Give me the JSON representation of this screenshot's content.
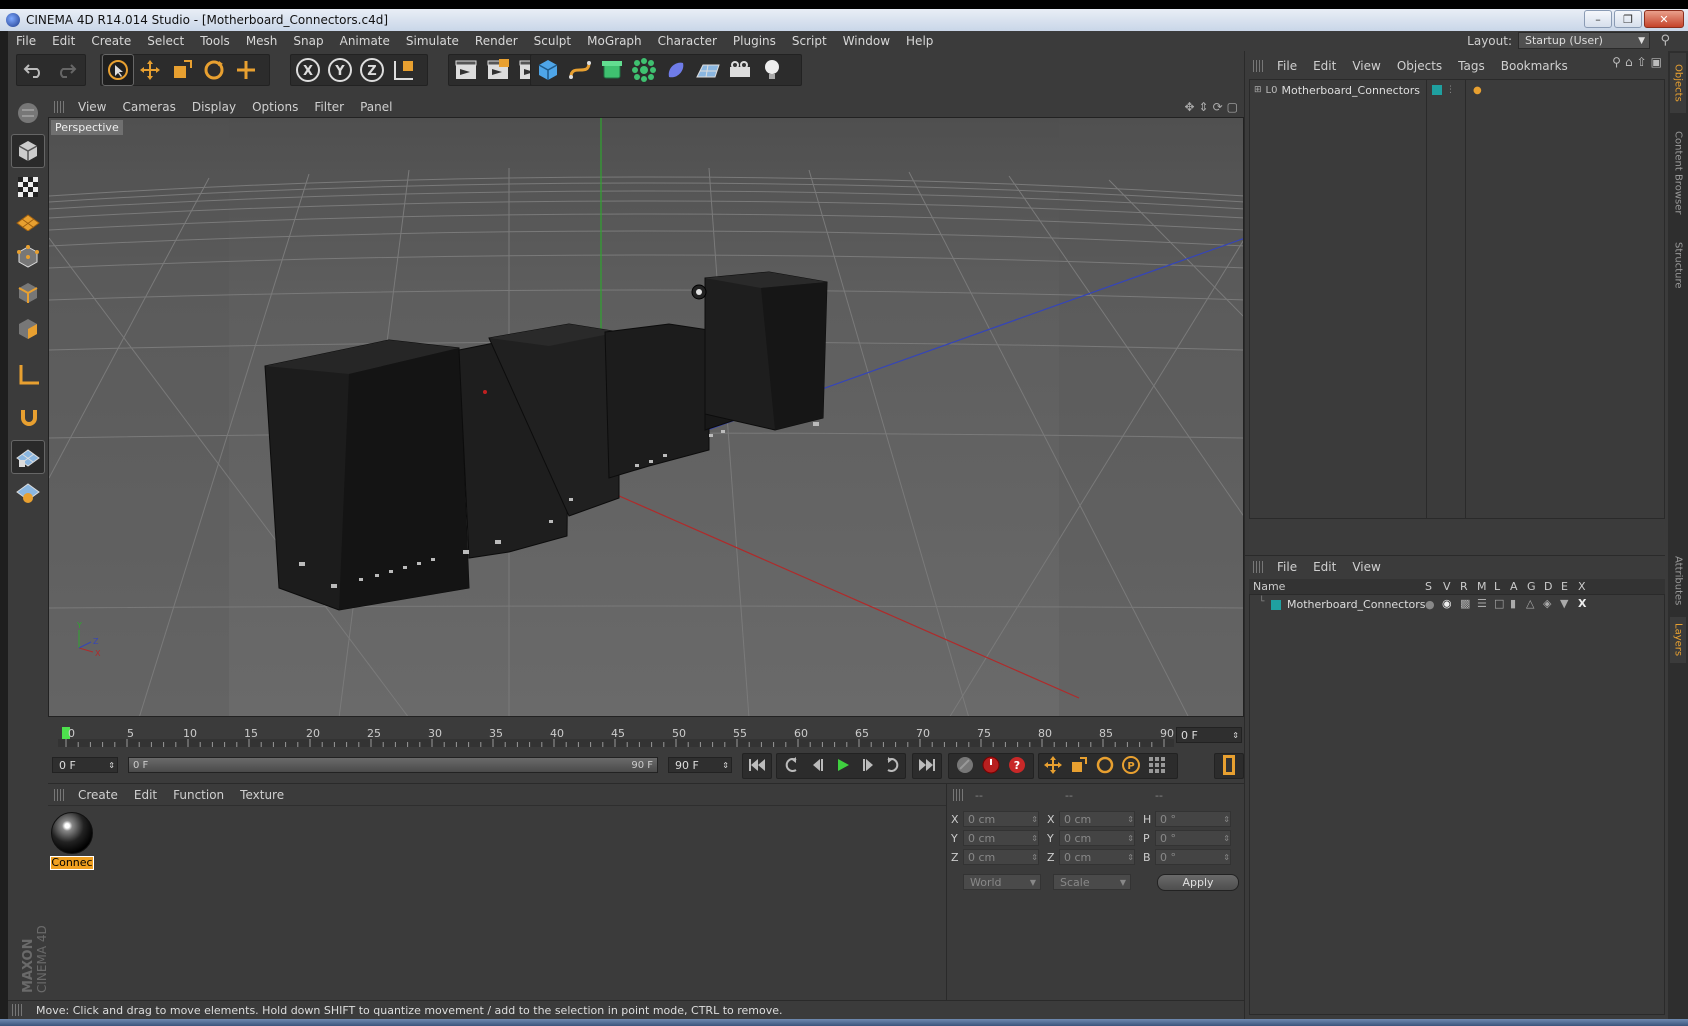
{
  "window": {
    "title": "CINEMA 4D R14.014 Studio - [Motherboard_Connectors.c4d]",
    "controls": [
      "minimize-icon",
      "restore-icon",
      "close-icon"
    ]
  },
  "menubar": {
    "items": [
      "File",
      "Edit",
      "Create",
      "Select",
      "Tools",
      "Mesh",
      "Snap",
      "Animate",
      "Simulate",
      "Render",
      "Sculpt",
      "MoGraph",
      "Character",
      "Plugins",
      "Script",
      "Window",
      "Help"
    ],
    "layout_label": "Layout:",
    "layout_value": "Startup (User)"
  },
  "toolbar": {
    "groups": [
      [
        "undo-icon",
        "redo-icon"
      ],
      [
        "live-selection-icon",
        "move-icon",
        "scale-icon",
        "rotate-icon",
        "add-icon"
      ],
      [
        "x-axis-icon",
        "y-axis-icon",
        "z-axis-icon",
        "coordinate-system-icon"
      ],
      [
        "render-view-icon",
        "render-picture-viewer-icon",
        "edit-render-settings-icon"
      ],
      [
        "cube-icon",
        "spline-icon",
        "nurbs-icon",
        "array-icon",
        "deformer-icon",
        "floor-icon",
        "camera-icon",
        "light-icon"
      ]
    ],
    "axis_letters": [
      "X",
      "Y",
      "Z"
    ]
  },
  "left_tools": [
    "model-mode-icon",
    "texture-mode-icon",
    "workplane-icon",
    "points-mode-icon",
    "edges-mode-icon",
    "polygons-mode-icon",
    "axis-mode-icon",
    "tweak-icon",
    "snap-grid-icon",
    "locked-workplane-icon"
  ],
  "viewport": {
    "menu": [
      "View",
      "Cameras",
      "Display",
      "Options",
      "Filter",
      "Panel"
    ],
    "label": "Perspective",
    "axis_labels": [
      "Y",
      "X",
      "Z"
    ],
    "colors": {
      "y_axis": "#2fa52f",
      "x_axis": "#b02a2a",
      "z_axis": "#3545b8"
    }
  },
  "timeline": {
    "ticks": [
      "0",
      "5",
      "10",
      "15",
      "20",
      "25",
      "30",
      "35",
      "40",
      "45",
      "50",
      "55",
      "60",
      "65",
      "70",
      "75",
      "80",
      "85",
      "90"
    ],
    "current_frame": "0 F"
  },
  "transport": {
    "start": "0 F",
    "range_start": "0 F",
    "range_end": "90 F",
    "end": "90 F",
    "buttons": [
      "go-to-start-icon",
      "previous-key-icon",
      "previous-frame-icon",
      "play-icon",
      "next-frame-icon",
      "next-key-icon",
      "go-to-end-icon"
    ],
    "record_buttons": [
      "motion-path-icon",
      "record-icon",
      "autokey-icon"
    ],
    "key_buttons": [
      "key-position-icon",
      "key-scale-icon",
      "key-rotation-icon",
      "key-param-icon",
      "key-pla-icon"
    ],
    "timeline_button": "timeline-icon"
  },
  "material_panel": {
    "menu": [
      "Create",
      "Edit",
      "Function",
      "Texture"
    ],
    "material_label": "Connec"
  },
  "coordinates": {
    "headers": [
      "--",
      "--",
      "--"
    ],
    "rows": [
      {
        "l1": "X",
        "v1": "0 cm",
        "l2": "X",
        "v2": "0 cm",
        "l3": "H",
        "v3": "0 °"
      },
      {
        "l1": "Y",
        "v1": "0 cm",
        "l2": "Y",
        "v2": "0 cm",
        "l3": "P",
        "v3": "0 °"
      },
      {
        "l1": "Z",
        "v1": "0 cm",
        "l2": "Z",
        "v2": "0 cm",
        "l3": "B",
        "v3": "0 °"
      }
    ],
    "space": "World",
    "mode": "Scale",
    "apply": "Apply"
  },
  "status": "Move: Click and drag to move elements. Hold down SHIFT to quantize movement / add to the selection in point mode, CTRL to remove.",
  "objects": {
    "menu": [
      "File",
      "Edit",
      "View",
      "Objects",
      "Tags",
      "Bookmarks"
    ],
    "item": "Motherboard_Connectors",
    "layer_color": "#1fa0a0"
  },
  "layers": {
    "menu": [
      "File",
      "Edit",
      "View"
    ],
    "columns": [
      "Name",
      "S",
      "V",
      "R",
      "M",
      "L",
      "A",
      "G",
      "D",
      "E",
      "X"
    ],
    "item": "Motherboard_Connectors"
  },
  "side_tabs": [
    "Objects",
    "Content Browser",
    "Structure",
    "Attributes",
    "Layers"
  ],
  "logo": {
    "brand": "MAXON",
    "product": "CINEMA 4D"
  }
}
